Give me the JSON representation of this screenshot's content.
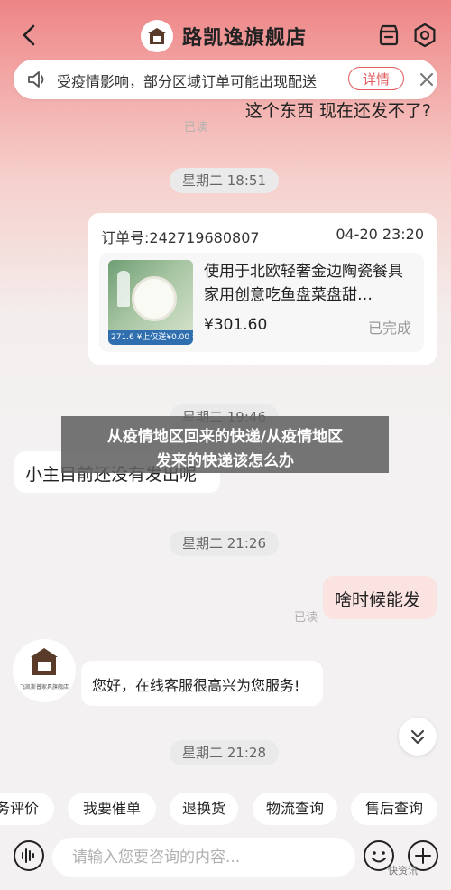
{
  "header": {
    "store_name": "路凯逸旗舰店",
    "store_logo_text": "路凯逸"
  },
  "notice": {
    "text": "受疫情影响，部分区域订单可能出现配送",
    "detail_label": "详情"
  },
  "messages": {
    "m1_text": "这个东西 现在还发不了?",
    "m1_read": "已读",
    "time1": "星期二 18:51",
    "order": {
      "order_no": "订单号:242719680807",
      "order_time": "04-20 23:20",
      "title": "使用于北欧轻奢金边陶瓷餐具家用创意吃鱼盘菜盘甜…",
      "price": "¥301.60",
      "status": "已完成",
      "thumb_tag": "271.6 ¥上仅送¥0.00 ¥0.00"
    },
    "time2": "星期二 19:46",
    "m2_text": "小主目前还没有发出呢",
    "time3": "星期二 21:26",
    "m3_text": "啥时候能发",
    "m3_read": "已读",
    "avatar_caption": "飞凯斯普家具旗舰店",
    "m4_text": "您好，在线客服很高兴为您服务!",
    "time4": "星期二 21:28"
  },
  "overlay": {
    "line1": "从疫情地区回来的快递/从疫情地区",
    "line2": "发来的快递该怎么办"
  },
  "quick_chips": [
    "务评价",
    "我要催单",
    "退换货",
    "物流查询",
    "售后查询"
  ],
  "input": {
    "placeholder": "请输入您要咨询的内容..."
  },
  "watermark": "快资讯",
  "colors": {
    "accent": "#e35a5e",
    "header_gradient_top": "#ee8486",
    "bubble_right": "#fbe3e1"
  }
}
